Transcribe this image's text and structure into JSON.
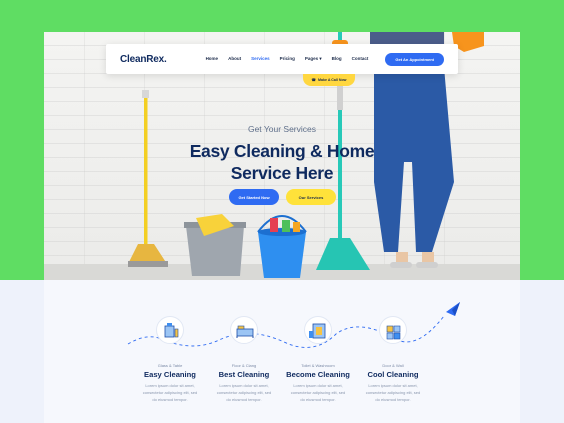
{
  "nav": {
    "logo": "CleanRex.",
    "links": [
      "Home",
      "About",
      "Services",
      "Pricing",
      "Pages",
      "Blog",
      "Contact"
    ],
    "active_index": 2,
    "cta": "Get An Appointment"
  },
  "call_pill": "Make A Call Now",
  "hero": {
    "subtitle": "Get Your Services",
    "title_line1": "Easy Cleaning & Home",
    "title_line2": "Service Here",
    "primary_button": "Get Started Now",
    "secondary_button": "Our Services"
  },
  "services": [
    {
      "category": "Glass & Table",
      "title": "Easy Cleaning",
      "desc_line1": "Lorem ipsum dolor sit amet,",
      "desc_line2": "consectetur adipiscing elit, sed",
      "desc_line3": "do eiusmod tempor."
    },
    {
      "category": "Floor & Clang",
      "title": "Best Cleaning",
      "desc_line1": "Lorem ipsum dolor sit amet,",
      "desc_line2": "consectetur adipiscing elit, sed",
      "desc_line3": "do eiusmod tempor."
    },
    {
      "category": "Toilet & Washroom",
      "title": "Become Cleaning",
      "desc_line1": "Lorem ipsum dolor sit amet,",
      "desc_line2": "consectetur adipiscing elit, sed",
      "desc_line3": "do eiusmod tempor."
    },
    {
      "category": "Door & Wall",
      "title": "Cool Cleaning",
      "desc_line1": "Lorem ipsum dolor sit amet,",
      "desc_line2": "consectetur adipiscing elit, sed",
      "desc_line3": "do eiusmod tempor."
    }
  ],
  "colors": {
    "background_green": "#5fdd63",
    "accent_blue": "#2f6bf2",
    "accent_yellow": "#ffe23a",
    "heading_navy": "#0f2a5f"
  },
  "icons": [
    "phone-icon",
    "chevron-down-icon",
    "window-cleaning-icon",
    "bed-cleaning-icon",
    "washroom-icon",
    "door-wall-icon",
    "paper-plane-icon"
  ]
}
